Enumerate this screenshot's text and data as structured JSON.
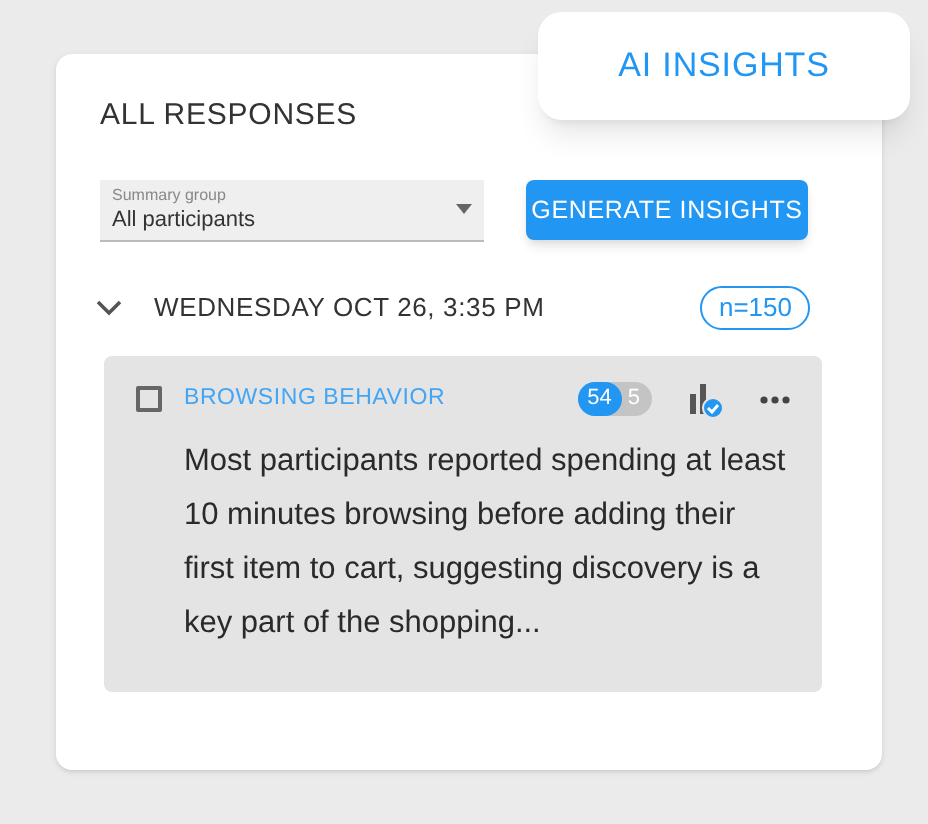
{
  "popup": {
    "title": "AI INSIGHTS"
  },
  "panel": {
    "title": "ALL RESPONSES"
  },
  "summary_group": {
    "label": "Summary group",
    "value": "All participants"
  },
  "generate_button": "GENERATE INSIGHTS",
  "session": {
    "date": "WEDNESDAY OCT 26, 3:35 PM",
    "expanded": true,
    "count": "n=150"
  },
  "insights": [
    {
      "checked": false,
      "title": "BROWSING BEHAVIOR",
      "positive": "54",
      "negative": "5",
      "text": "Most participants reported spending at least 10 minutes browsing before adding their first item to cart, suggesting discovery is a key part of the shopping..."
    }
  ]
}
